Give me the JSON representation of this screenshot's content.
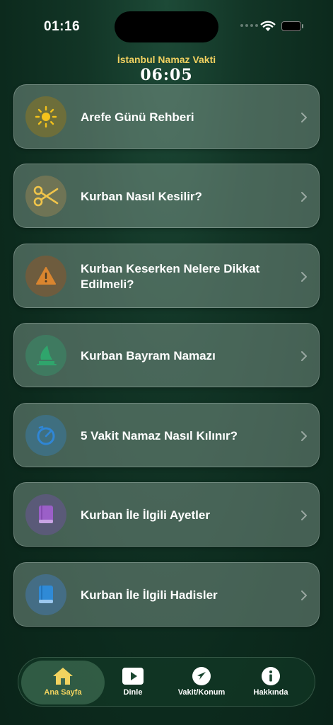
{
  "status": {
    "time": "01:16"
  },
  "header": {
    "title": "İstanbul Namaz Vakti",
    "time": "06:05"
  },
  "menu": {
    "items": [
      {
        "label": "Arefe Günü Rehberi",
        "icon": "sun-icon",
        "icon_bg": "#6d6e3a"
      },
      {
        "label": "Kurban Nasıl Kesilir?",
        "icon": "scissors-icon",
        "icon_bg": "#6f7455"
      },
      {
        "label": "Kurban Keserken Nelere Dikkat Edilmeli?",
        "icon": "warning-icon",
        "icon_bg": "#6e5c3e"
      },
      {
        "label": "Kurban Bayram Namazı",
        "icon": "mosque-icon",
        "icon_bg": "#3f7a60"
      },
      {
        "label": "5 Vakit Namaz Nasıl Kılınır?",
        "icon": "timer-icon",
        "icon_bg": "#3f6f80"
      },
      {
        "label": "Kurban İle İlgili Ayetler",
        "icon": "book-icon",
        "icon_bg": "#5a5a78"
      },
      {
        "label": "Kurban İle İlgili Hadisler",
        "icon": "book-icon",
        "icon_bg": "#446d85"
      }
    ]
  },
  "tabbar": {
    "tabs": [
      {
        "label": "Ana Sayfa",
        "icon": "home-icon",
        "active": true
      },
      {
        "label": "Dinle",
        "icon": "play-icon",
        "active": false
      },
      {
        "label": "Vakit/Konum",
        "icon": "location-arrow-icon",
        "active": false
      },
      {
        "label": "Hakkında",
        "icon": "info-icon",
        "active": false
      }
    ]
  },
  "colors": {
    "accent": "#f2d35f",
    "background": "#0f3022"
  }
}
